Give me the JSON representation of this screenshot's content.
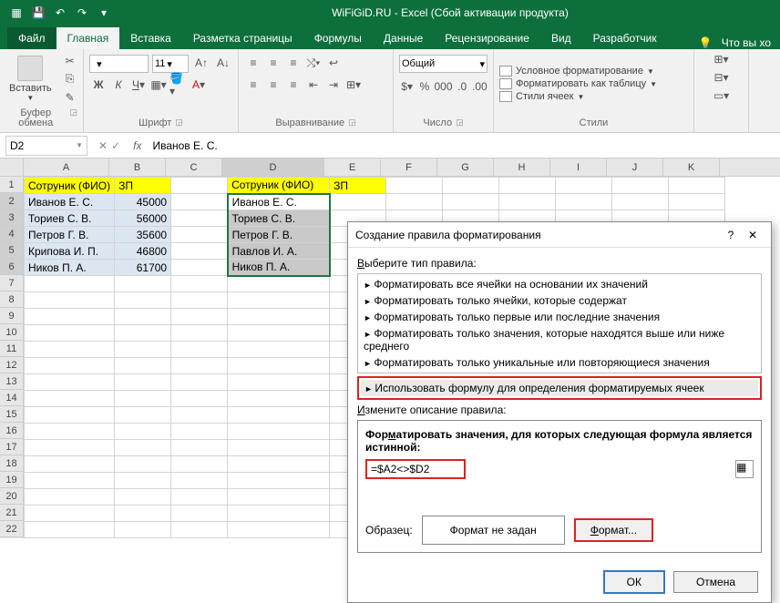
{
  "title": "WiFiGiD.RU - Excel (Сбой активации продукта)",
  "tabs": {
    "file": "Файл",
    "home": "Главная",
    "insert": "Вставка",
    "layout": "Разметка страницы",
    "formulas": "Формулы",
    "data": "Данные",
    "review": "Рецензирование",
    "view": "Вид",
    "developer": "Разработчик",
    "tellme": "Что вы хо"
  },
  "ribbon": {
    "paste": "Вставить",
    "clipboard": "Буфер обмена",
    "font_size": "11",
    "font_group": "Шрифт",
    "align_group": "Выравнивание",
    "number_format": "Общий",
    "number_group": "Число",
    "cond_fmt": "Условное форматирование",
    "fmt_table": "Форматировать как таблицу",
    "cell_styles": "Стили ячеек",
    "styles_group": "Стили"
  },
  "fx": {
    "name": "D2",
    "formula": "Иванов Е. С.",
    "fx_label": "fx"
  },
  "cols": [
    "A",
    "B",
    "C",
    "D",
    "E",
    "F",
    "G",
    "H",
    "I",
    "J",
    "K"
  ],
  "table1": {
    "hdr": [
      "Сотруник (ФИО)",
      "ЗП"
    ],
    "rows": [
      [
        "Иванов Е. С.",
        "45000"
      ],
      [
        "Ториев С. В.",
        "56000"
      ],
      [
        "Петров Г. В.",
        "35600"
      ],
      [
        "Крипова И. П.",
        "46800"
      ],
      [
        "Ников П. А.",
        "61700"
      ]
    ]
  },
  "table2": {
    "hdr": [
      "Сотруник (ФИО)",
      "ЗП"
    ],
    "rows": [
      "Иванов Е. С.",
      "Ториев С. В.",
      "Петров Г. В.",
      "Павлов И. А.",
      "Ников П. А."
    ]
  },
  "dialog": {
    "title": "Создание правила форматирования",
    "select_type": "Выберите тип правила:",
    "rules": [
      "Форматировать все ячейки на основании их значений",
      "Форматировать только ячейки, которые содержат",
      "Форматировать только первые или последние значения",
      "Форматировать только значения, которые находятся выше или ниже среднего",
      "Форматировать только уникальные или повторяющиеся значения"
    ],
    "rule_selected": "Использовать формулу для определения форматируемых ячеек",
    "edit_desc": "Измените описание правила:",
    "formula_label": "Форматировать значения, для которых следующая формула является истинной:",
    "formula": "=$A2<>$D2",
    "sample_label": "Образец:",
    "sample_text": "Формат не задан",
    "format_btn": "Формат...",
    "ok": "ОК",
    "cancel": "Отмена"
  }
}
